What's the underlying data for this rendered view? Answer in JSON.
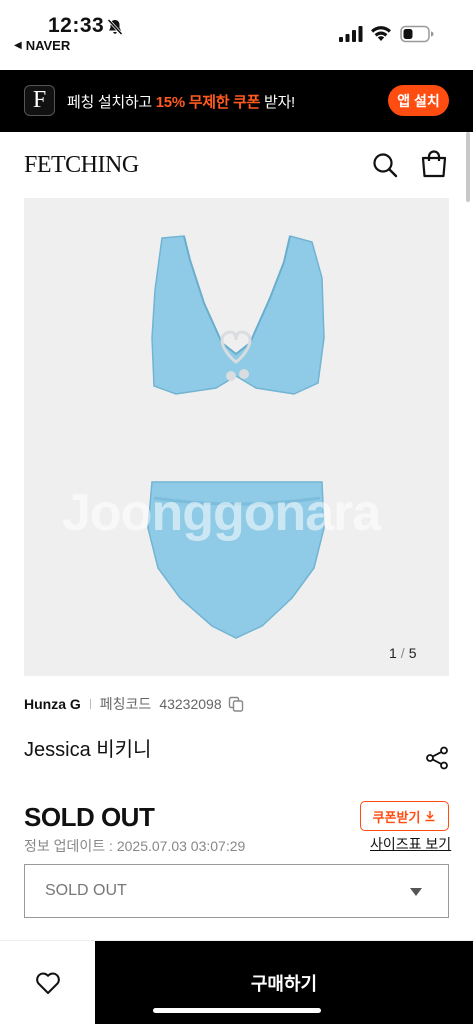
{
  "status_bar": {
    "time": "12:33",
    "back_app": "NAVER",
    "icons": [
      "bell-slash-icon",
      "signal-icon",
      "wifi-icon",
      "battery-icon"
    ]
  },
  "promo": {
    "logo_letter": "F",
    "text_before": "페칭 설치하고 ",
    "text_highlight": "15% 무제한 쿠폰",
    "text_after": " 받자!",
    "button_label": "앱 설치",
    "accent_color": "#ff4d12"
  },
  "header": {
    "brand": "FETCHING",
    "icons": [
      "search-icon",
      "shopping-bag-icon"
    ]
  },
  "gallery": {
    "watermark": "Joonggonara",
    "current": "1",
    "separator": "/",
    "total": "5",
    "product_color": "#8fcbe6"
  },
  "product": {
    "brand": "Hunza G",
    "code_label": "페칭코드",
    "code_value": "43232098",
    "title": "Jessica 비키니",
    "price_status": "SOLD OUT",
    "update_info": "정보 업데이트 : 2025.07.03 03:07:29",
    "coupon_label": "쿠폰받기",
    "size_chart_label": "사이즈표 보기",
    "option_selected": "SOLD OUT"
  },
  "bottom_bar": {
    "buy_label": "구매하기",
    "wish_icon": "heart-icon"
  }
}
